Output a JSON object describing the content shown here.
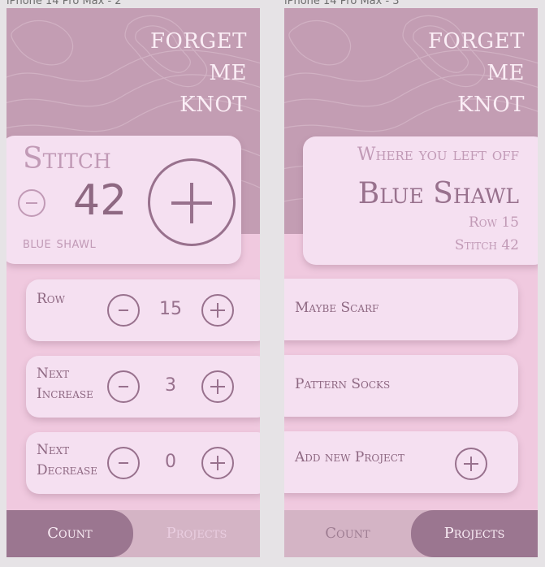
{
  "frames": [
    "iPhone 14 Pro Max - 2",
    "iPhone 14 Pro Max - 3"
  ],
  "logo": [
    "FORGET",
    "ME",
    "KNOT"
  ],
  "count_screen": {
    "stitch_label": "Stitch",
    "stitch_count": "42",
    "project_name": "blue shawl",
    "counters": [
      {
        "label_lines": [
          "Row"
        ],
        "value": "15"
      },
      {
        "label_lines": [
          "Next",
          "Increase"
        ],
        "value": "3"
      },
      {
        "label_lines": [
          "Next",
          "Decrease"
        ],
        "value": "0"
      }
    ]
  },
  "projects_screen": {
    "left_off_title": "Where you left off",
    "left_off_name": "Blue Shawl",
    "left_off_row": "Row 15",
    "left_off_stitch": "Stitch 42",
    "projects": [
      "Maybe Scarf",
      "Pattern Socks"
    ],
    "add_project_label": "Add new Project"
  },
  "tabs": {
    "count": "Count",
    "projects": "Projects"
  },
  "colors": {
    "header": "#c39db3",
    "background": "#f0c9df",
    "card": "#f5e0f1",
    "accent": "#98718d",
    "tab_active": "#9b7690"
  }
}
